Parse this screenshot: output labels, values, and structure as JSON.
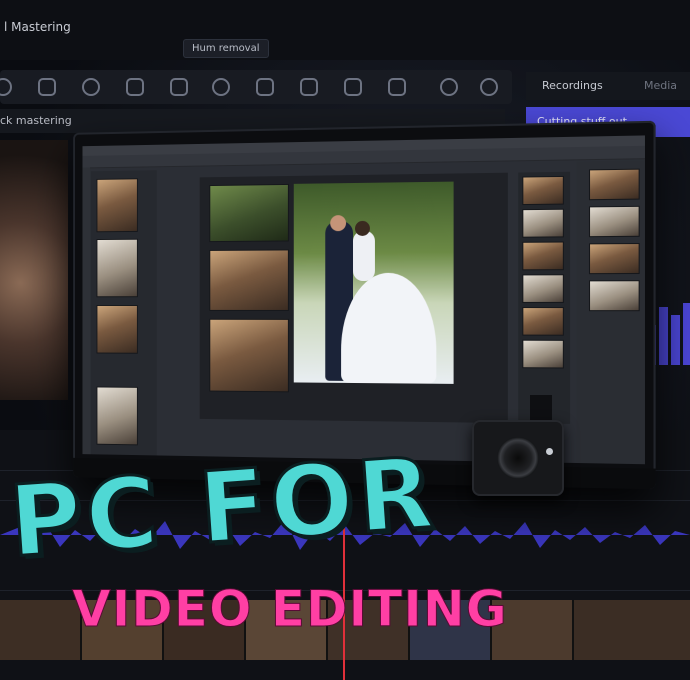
{
  "background_ui": {
    "app_title": "l Mastering",
    "tooltip": "Hum removal",
    "right_tabs": {
      "recordings": "Recordings",
      "media": "Media"
    },
    "selected_item": "Cutting stuff out",
    "panel_title": "ck mastering"
  },
  "headline": {
    "line1": "PC FOR",
    "line2": "VIDEO EDITING",
    "line1_color": "#4fd8d4",
    "line2_color": "#ff3fa4"
  },
  "colors": {
    "accent": "#4a48d6",
    "playhead": "#e0303a"
  }
}
